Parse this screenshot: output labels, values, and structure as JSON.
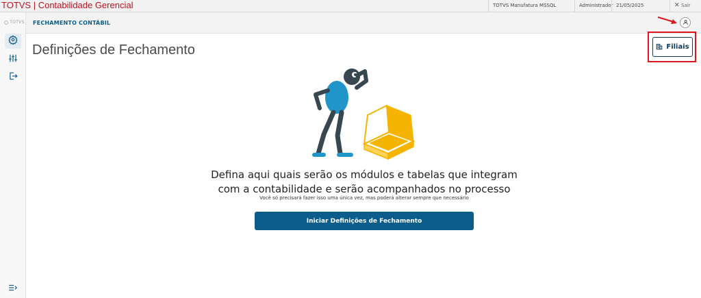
{
  "window": {
    "app_title": "TOTVS | Contabilidade Gerencial",
    "environment": "TOTVS Manufatura MSSQL",
    "user": "Administrador",
    "date": "21/05/2025",
    "logout_label": "Sair"
  },
  "sidebar": {
    "logo": "TOTVS",
    "items": [
      {
        "icon": "gear-icon",
        "active": true
      },
      {
        "icon": "sliders-icon",
        "active": false
      },
      {
        "icon": "exit-icon",
        "active": false
      }
    ],
    "bottom_icon": "menu-collapse-icon"
  },
  "header": {
    "module_name": "FECHAMENTO CONTÁBIL",
    "user_icon": "user-icon"
  },
  "main": {
    "page_title": "Definições de Fechamento",
    "branches_button_label": "Filiais",
    "headline_line1": "Defina aqui quais serão os módulos e tabelas que integram",
    "headline_line2": "com a contabilidade e serão acompanhados no processo",
    "subline": "Você só precisará fazer isso uma única vez, mas poderá alterar sempre que necessário",
    "cta_label": "Iniciar Definições de Fechamento"
  },
  "colors": {
    "brand_red": "#c0101f",
    "primary_blue": "#0c5c8c",
    "highlight_red": "#e0141c",
    "box_yellow": "#f5b400",
    "figure_blue": "#1f95c9"
  }
}
